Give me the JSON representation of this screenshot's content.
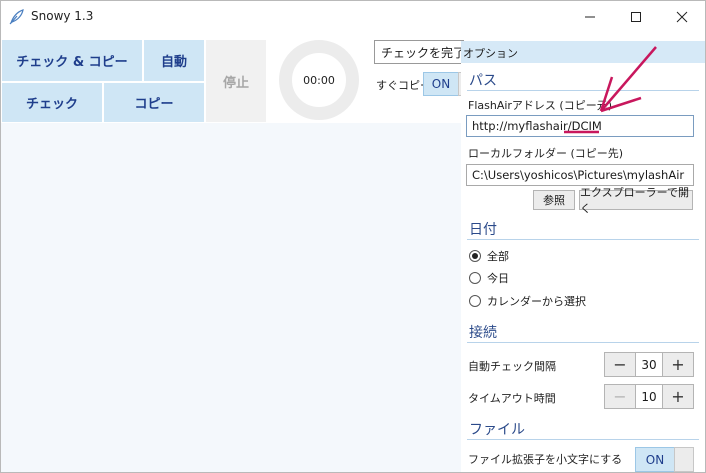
{
  "window": {
    "title": "Snowy 1.3"
  },
  "toolbar": {
    "check_copy_label": "チェック & コピー",
    "auto_label": "自動",
    "stop_label": "停止",
    "check_label": "チェック",
    "copy_label": "コピー",
    "timer_value": "00:00",
    "after_check_value": "チェックを完了し",
    "instant_copy_label": "すぐコピー",
    "instant_copy_toggle": "ON"
  },
  "options": {
    "header": "オプション",
    "path_section": "パス",
    "flashair_label": "FlashAirアドレス (コピー元)",
    "flashair_value": "http://myflashair/DCIM",
    "local_label": "ローカルフォルダー (コピー先)",
    "local_value": "C:\\Users\\yoshicos\\Pictures\\mylashAir",
    "browse_label": "参照",
    "explorer_label": "エクスプローラーで開く",
    "date_section": "日付",
    "date_options": [
      "全部",
      "今日",
      "カレンダーから選択"
    ],
    "date_selected": "全部",
    "connection_section": "接続",
    "auto_check_interval_label": "自動チェック間隔",
    "auto_check_interval_value": "30",
    "timeout_label": "タイムアウト時間",
    "timeout_value": "10",
    "file_section": "ファイル",
    "lowercase_ext_label": "ファイル拡張子を小文字にする",
    "lowercase_ext_toggle": "ON"
  },
  "colors": {
    "accent_blue": "#cfe6f5",
    "header_blue": "#d6e9f7",
    "text_blue": "#1f3e8c",
    "annotation": "#c8175d"
  }
}
